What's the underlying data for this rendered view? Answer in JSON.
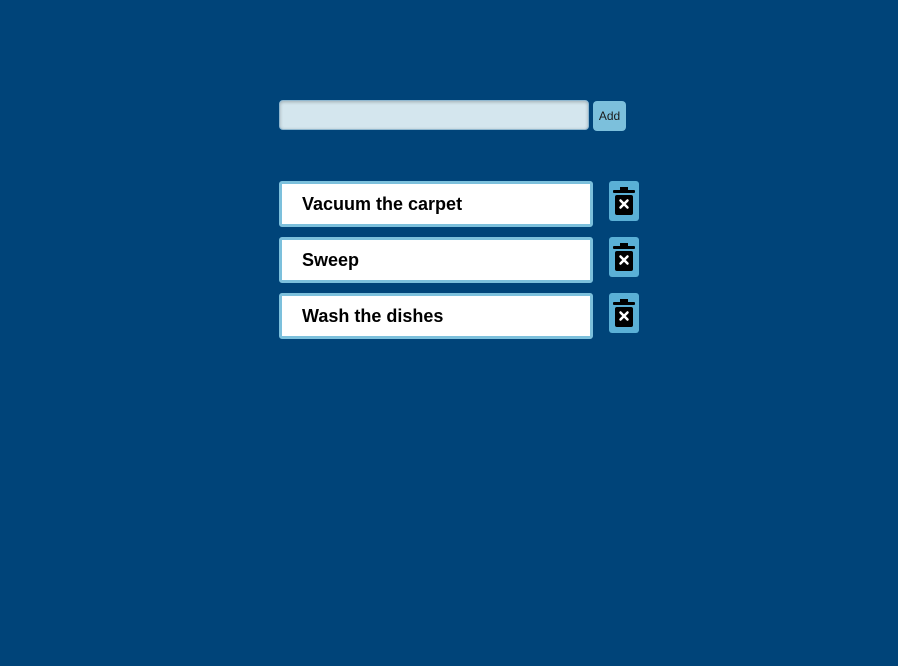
{
  "add_form": {
    "input_value": "",
    "input_placeholder": "",
    "add_label": "Add"
  },
  "tasks": [
    {
      "text": "Vacuum the carpet",
      "delete_icon": "trash-x-icon"
    },
    {
      "text": "Sweep",
      "delete_icon": "trash-x-icon"
    },
    {
      "text": "Wash the dishes",
      "delete_icon": "trash-x-icon"
    }
  ],
  "colors": {
    "background": "#004479",
    "accent": "#7cc0dc",
    "delete_button": "#5ab0d6",
    "input_background": "#d4e6ee"
  }
}
